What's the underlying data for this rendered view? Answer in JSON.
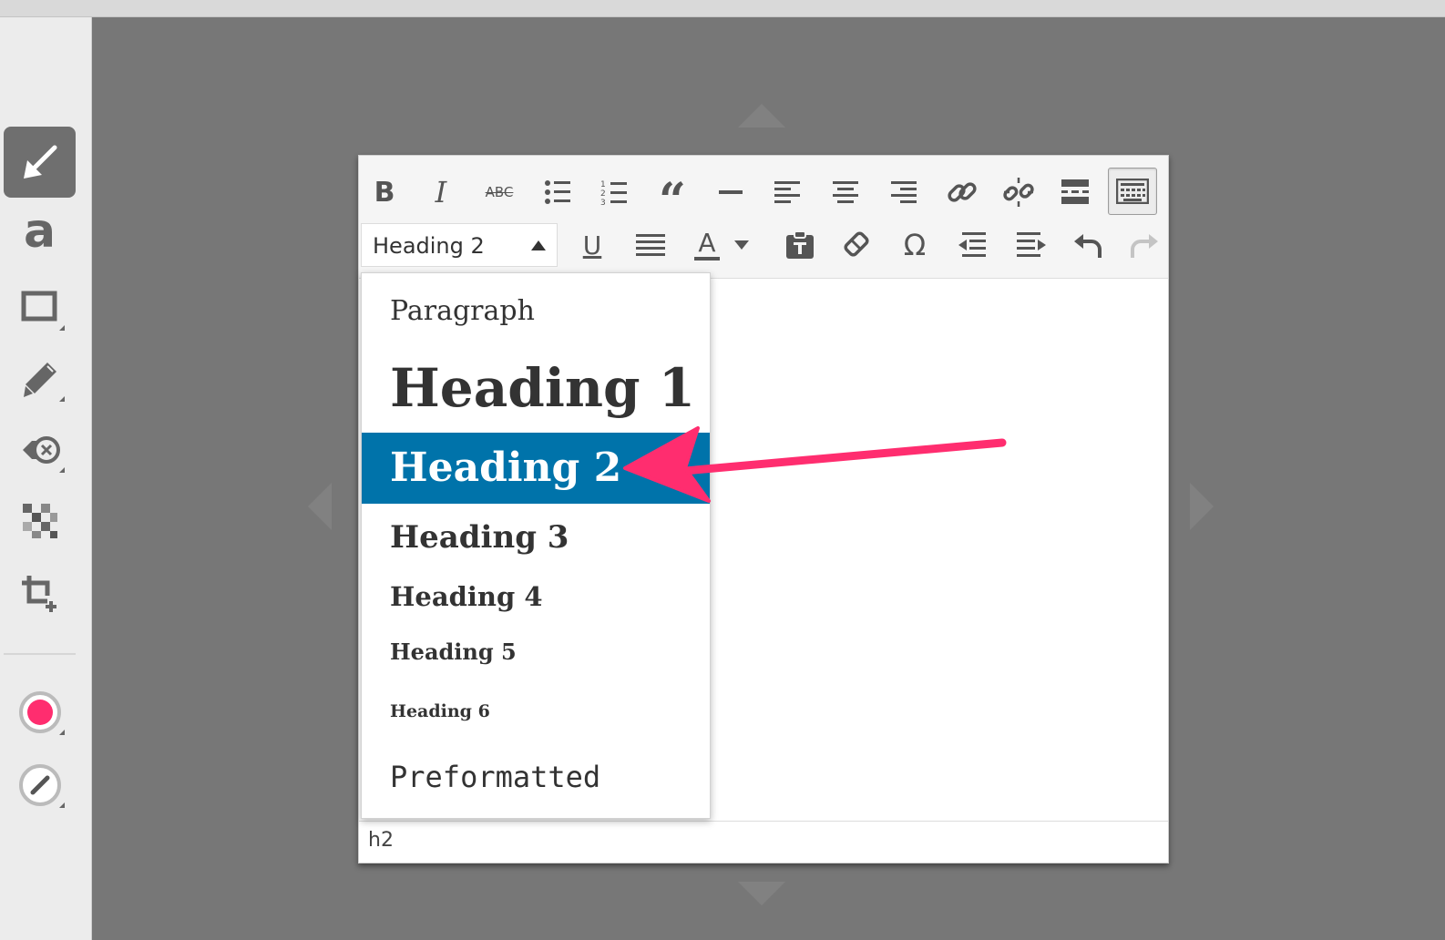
{
  "left_toolbar": {
    "tools": [
      {
        "name": "arrow-tool",
        "icon": "arrow-icon",
        "active": true
      },
      {
        "name": "text-tool",
        "icon": "text-a-icon",
        "label": "a"
      },
      {
        "name": "rectangle-tool",
        "icon": "rectangle-icon"
      },
      {
        "name": "highlighter-tool",
        "icon": "highlighter-icon"
      },
      {
        "name": "blur-eraser-tool",
        "icon": "eraser-icon"
      },
      {
        "name": "pixelate-tool",
        "icon": "pixelate-icon"
      },
      {
        "name": "crop-tool",
        "icon": "crop-icon"
      },
      {
        "name": "color-tool",
        "icon": "color-swatch-icon",
        "color": "#ff2d6f"
      },
      {
        "name": "line-width-tool",
        "icon": "line-width-icon"
      }
    ]
  },
  "editor": {
    "toolbar_row1": [
      "bold-icon",
      "italic-icon",
      "strikethrough-icon",
      "bullet-list-icon",
      "numbered-list-icon",
      "blockquote-icon",
      "horizontal-rule-icon",
      "align-left-icon",
      "align-center-icon",
      "align-right-icon",
      "link-icon",
      "unlink-icon",
      "read-more-icon",
      "toolbar-toggle-icon"
    ],
    "toolbar_row2": [
      "underline-icon",
      "justify-icon",
      "text-color-icon",
      "text-color-dropdown-icon",
      "paste-as-text-icon",
      "clear-formatting-icon",
      "special-character-icon",
      "outdent-icon",
      "indent-icon",
      "undo-icon",
      "redo-icon"
    ],
    "bold_label": "B",
    "italic_label": "I",
    "strike_label": "ABC",
    "underline_label": "U",
    "text_color_label": "A",
    "special_char_label": "Ω",
    "quote_label": "“",
    "format_select": {
      "value": "Heading 2"
    },
    "format_options": [
      {
        "label": "Paragraph",
        "selected": false
      },
      {
        "label": "Heading 1",
        "selected": false
      },
      {
        "label": "Heading 2",
        "selected": true
      },
      {
        "label": "Heading 3",
        "selected": false
      },
      {
        "label": "Heading 4",
        "selected": false
      },
      {
        "label": "Heading 5",
        "selected": false
      },
      {
        "label": "Heading 6",
        "selected": false
      },
      {
        "label": "Preformatted",
        "selected": false
      }
    ],
    "status_path": "h2"
  },
  "colors": {
    "selected_option_bg": "#0073aa",
    "annotation_arrow": "#ff2d6f",
    "canvas_bg": "#777777"
  }
}
